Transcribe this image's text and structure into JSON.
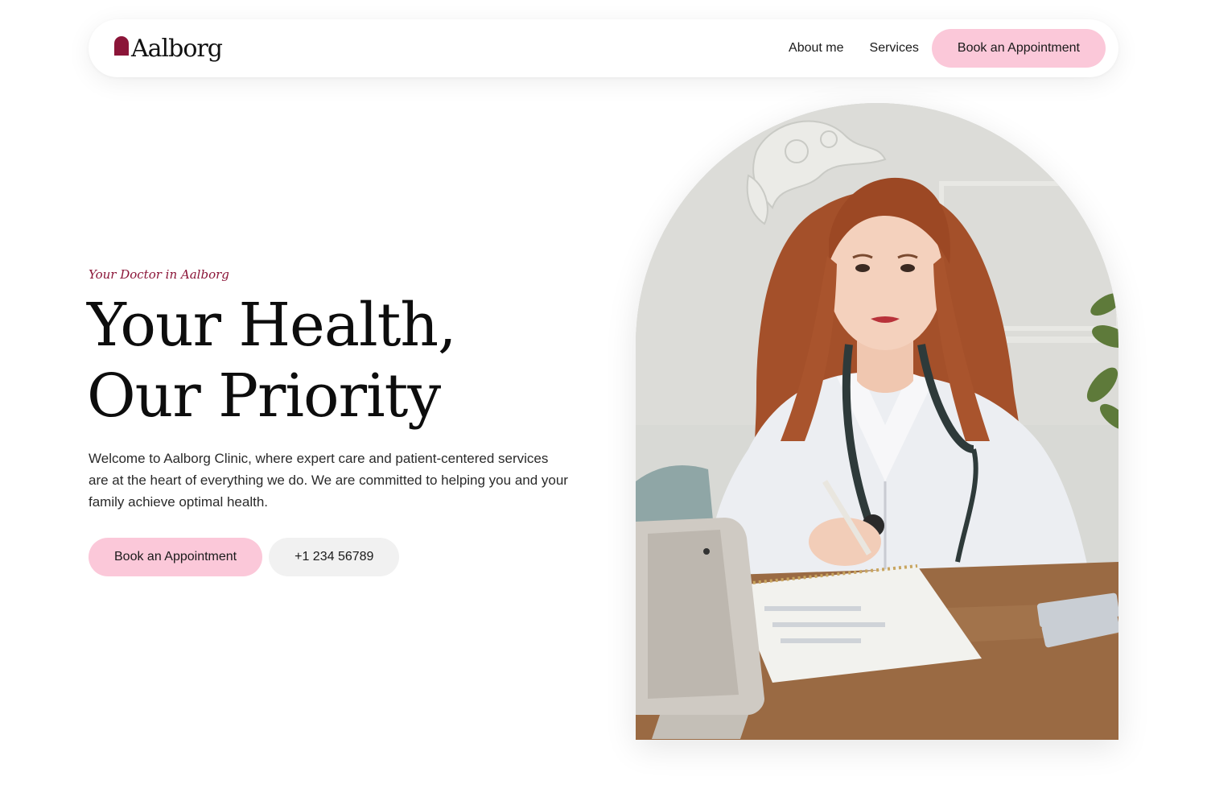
{
  "brand": {
    "name": "Aalborg",
    "accent_color": "#8b1538",
    "button_pink": "#fbc8d9",
    "button_grey": "#f1f1f1"
  },
  "nav": {
    "links": [
      "About me",
      "Services"
    ],
    "cta_label": "Book an Appointment"
  },
  "hero": {
    "eyebrow": "Your Doctor in Aalborg",
    "headline_line1": "Your Health,",
    "headline_line2": "Our Priority",
    "intro": "Welcome to Aalborg Clinic, where expert care and patient-centered services are at the heart of everything we do. We are committed to helping you and your family achieve optimal health.",
    "primary_cta": "Book an Appointment",
    "secondary_cta": "+1 234 56789",
    "image_subject": "doctor-with-stethoscope-writing-at-desk"
  }
}
